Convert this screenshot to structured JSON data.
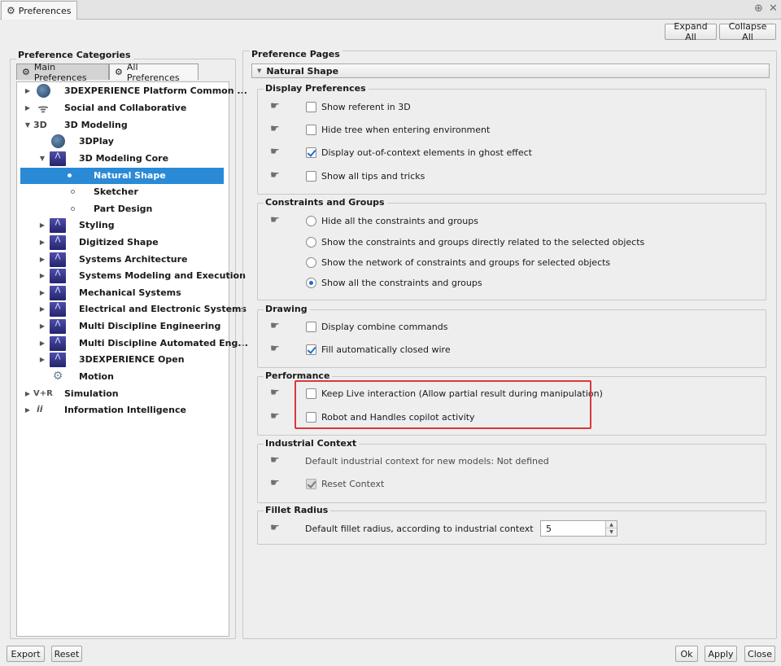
{
  "window": {
    "title": "Preferences",
    "icon": "gear-icon"
  },
  "toolbar": {
    "expand_all": "Expand All",
    "collapse_all": "Collapse All"
  },
  "categories": {
    "title": "Preference Categories",
    "tabs": [
      {
        "label": "Main Preferences",
        "icon": "gear-icon",
        "selected": true
      },
      {
        "label": "All Preferences",
        "icon": "gear-icon",
        "selected": false
      }
    ],
    "tree": [
      {
        "label": "3DEXPERIENCE Platform Common ...",
        "level": 1,
        "expander": "collapsed",
        "icon": "globe-icon"
      },
      {
        "label": "Social and Collaborative",
        "level": 1,
        "expander": "collapsed",
        "icon": "antenna-icon"
      },
      {
        "label": "3D Modeling",
        "level": 1,
        "expander": "expanded",
        "icon": "3d-icon",
        "icon_text": "3D"
      },
      {
        "label": "3DPlay",
        "level": 2,
        "expander": "none",
        "icon": "globe-icon"
      },
      {
        "label": "3D Modeling Core",
        "level": 2,
        "expander": "expanded",
        "icon": "cube-icon"
      },
      {
        "label": "Natural Shape",
        "level": 3,
        "expander": "none",
        "icon": "dot-icon",
        "selected": true
      },
      {
        "label": "Sketcher",
        "level": 3,
        "expander": "none",
        "icon": "dot-icon"
      },
      {
        "label": "Part Design",
        "level": 3,
        "expander": "none",
        "icon": "dot-icon"
      },
      {
        "label": "Styling",
        "level": 2,
        "expander": "collapsed",
        "icon": "cube-icon"
      },
      {
        "label": "Digitized Shape",
        "level": 2,
        "expander": "collapsed",
        "icon": "cube-icon"
      },
      {
        "label": "Systems Architecture",
        "level": 2,
        "expander": "collapsed",
        "icon": "cube-icon"
      },
      {
        "label": "Systems Modeling and Execution",
        "level": 2,
        "expander": "collapsed",
        "icon": "cube-icon"
      },
      {
        "label": "Mechanical Systems",
        "level": 2,
        "expander": "collapsed",
        "icon": "cube-icon"
      },
      {
        "label": "Electrical and Electronic Systems",
        "level": 2,
        "expander": "collapsed",
        "icon": "cube-icon"
      },
      {
        "label": "Multi Discipline Engineering",
        "level": 2,
        "expander": "collapsed",
        "icon": "cube-icon"
      },
      {
        "label": "Multi Discipline Automated Eng...",
        "level": 2,
        "expander": "collapsed",
        "icon": "cube-icon"
      },
      {
        "label": "3DEXPERIENCE Open",
        "level": 2,
        "expander": "collapsed",
        "icon": "cube-icon"
      },
      {
        "label": "Motion",
        "level": 2,
        "expander": "none",
        "icon": "robot-icon"
      },
      {
        "label": "Simulation",
        "level": 1,
        "expander": "collapsed",
        "icon": "vr-icon",
        "icon_text": "V+R"
      },
      {
        "label": "Information Intelligence",
        "level": 1,
        "expander": "collapsed",
        "icon": "info-icon",
        "icon_text": "ii"
      }
    ]
  },
  "pages": {
    "title": "Preference Pages",
    "section": "Natural Shape",
    "groups": {
      "display": {
        "title": "Display Preferences",
        "items": [
          {
            "label": "Show referent in 3D",
            "checked": false
          },
          {
            "label": "Hide tree when entering environment",
            "checked": false
          },
          {
            "label": "Display out-of-context elements in ghost effect",
            "checked": true
          },
          {
            "label": "Show all tips and tricks",
            "checked": false
          }
        ]
      },
      "constraints": {
        "title": "Constraints and Groups",
        "items": [
          {
            "label": "Hide all the constraints and groups",
            "selected": false
          },
          {
            "label": "Show the constraints and groups directly related to the selected objects",
            "selected": false
          },
          {
            "label": "Show the network of constraints and groups for selected objects",
            "selected": false
          },
          {
            "label": "Show all the constraints and groups",
            "selected": true
          }
        ]
      },
      "drawing": {
        "title": "Drawing",
        "items": [
          {
            "label": "Display combine commands",
            "checked": false
          },
          {
            "label": "Fill automatically closed wire",
            "checked": true
          }
        ]
      },
      "performance": {
        "title": "Performance",
        "items": [
          {
            "label": "Keep Live interaction (Allow partial result during manipulation)",
            "checked": false
          },
          {
            "label": "Robot and Handles copilot activity",
            "checked": false
          }
        ]
      },
      "industrial": {
        "title": "Industrial Context",
        "default_text": "Default industrial context for new models: Not defined",
        "reset_label": "Reset Context",
        "reset_checked": true
      },
      "fillet": {
        "title": "Fillet Radius",
        "label": "Default fillet radius, according to industrial context",
        "value": "5"
      }
    }
  },
  "footer": {
    "export": "Export",
    "reset": "Reset",
    "ok": "Ok",
    "apply": "Apply",
    "close": "Close"
  },
  "colors": {
    "selection": "#2a8ad6",
    "highlight": "#d9383a",
    "check": "#1e70c9"
  }
}
